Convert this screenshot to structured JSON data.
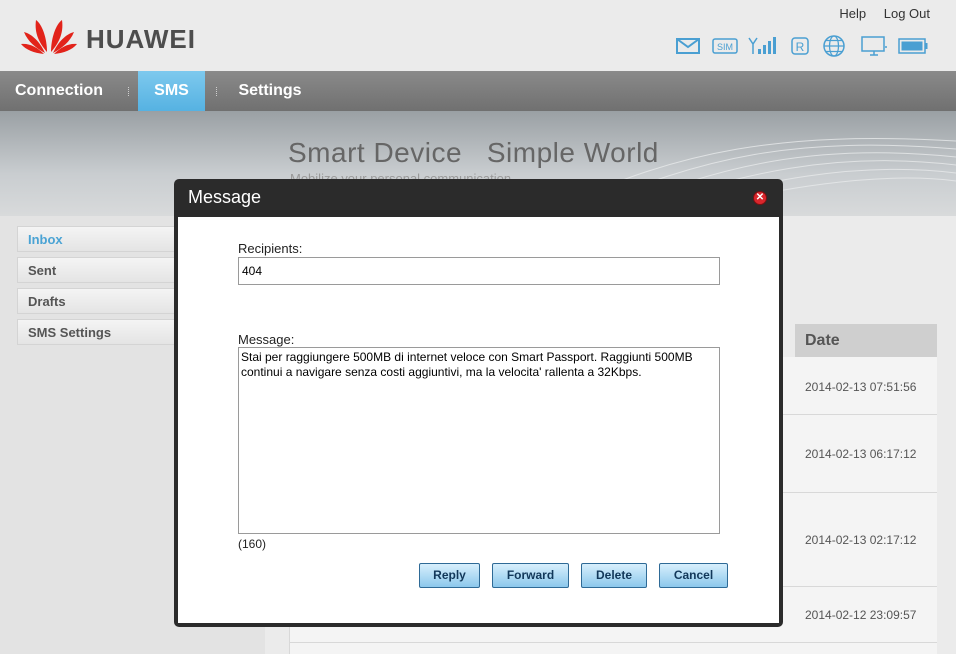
{
  "header": {
    "brand": "HUAWEI",
    "links": {
      "help": "Help",
      "logout": "Log Out"
    },
    "status_icons": [
      "mail-icon",
      "sim-icon",
      "signal-icon",
      "roaming-icon",
      "globe-icon",
      "computer-icon",
      "battery-icon"
    ],
    "sim_text": "SIM",
    "roaming_text": "R"
  },
  "nav": {
    "items": [
      "Connection",
      "SMS",
      "Settings"
    ],
    "active": "SMS"
  },
  "banner": {
    "title": "Smart Device   Simple World",
    "subtitle": "Mobilize your personal communication"
  },
  "sidebar": {
    "items": [
      "Inbox",
      "Sent",
      "Drafts",
      "SMS Settings"
    ],
    "active": "Inbox"
  },
  "table": {
    "date_header": "Date",
    "dates": [
      "2014-02-13 07:51:56",
      "2014-02-13 06:17:12",
      "2014-02-13 02:17:12",
      "2014-02-12 23:09:57"
    ]
  },
  "dialog": {
    "title": "Message",
    "recipients_label": "Recipients:",
    "recipients_value": "404",
    "message_label": "Message:",
    "message_value": "Stai per raggiungere 500MB di internet veloce con Smart Passport. Raggiunti 500MB continui a navigare senza costi aggiuntivi, ma la velocita' rallenta a 32Kbps.",
    "char_count": "(160)",
    "buttons": {
      "reply": "Reply",
      "forward": "Forward",
      "delete": "Delete",
      "cancel": "Cancel"
    }
  },
  "colors": {
    "accent": "#56b2e2",
    "logo": "#e2231a",
    "dialog_frame": "#2b2b2b"
  }
}
